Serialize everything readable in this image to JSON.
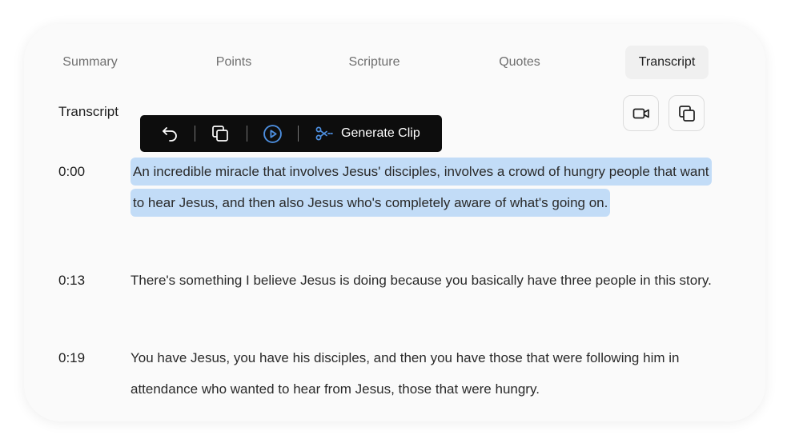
{
  "tabs": [
    {
      "label": "Summary"
    },
    {
      "label": "Points"
    },
    {
      "label": "Scripture"
    },
    {
      "label": "Quotes"
    },
    {
      "label": "Transcript",
      "active": true
    }
  ],
  "section": {
    "title": "Transcript"
  },
  "toolbar": {
    "generate_label": "Generate Clip"
  },
  "icons": {
    "undo": "undo-icon",
    "copy": "copy-icon",
    "play": "play-circle-icon",
    "scissors": "scissors-icon",
    "video": "video-camera-icon",
    "copy_all": "copy-icon"
  },
  "colors": {
    "highlight": "#c2dcf7",
    "play_accent": "#4d8fe0",
    "toolbar_bg": "#0d0d0d"
  },
  "transcript": [
    {
      "time": "0:00",
      "text": "An incredible miracle that involves Jesus' disciples, involves a crowd of hungry people that want to hear Jesus, and then also Jesus who's completely aware of what's going on.",
      "selected": true
    },
    {
      "time": "0:13",
      "text": "There's something I believe Jesus is doing because you basically have three people in this story."
    },
    {
      "time": "0:19",
      "text": "You have Jesus, you have his disciples, and then you have those that were following him in attendance who wanted to hear from Jesus, those that were hungry."
    }
  ]
}
